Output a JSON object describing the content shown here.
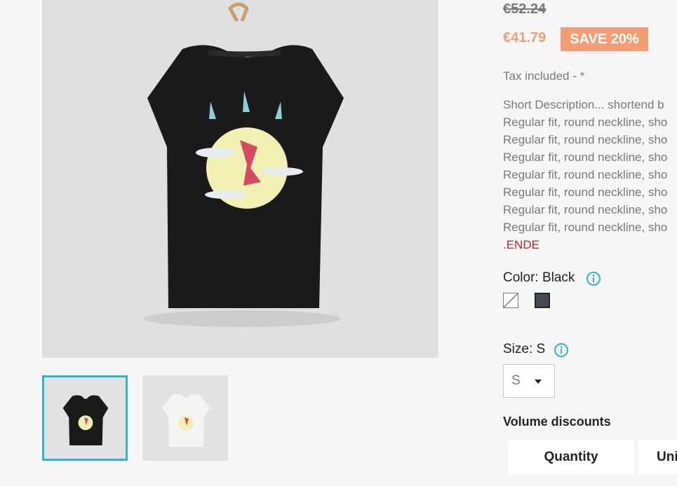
{
  "product": {
    "old_price": "€52.24",
    "price": "€41.79",
    "discount_badge": "SAVE 20%",
    "tax_note": "Tax included - *",
    "description_lines": [
      "Short Description... shortend b",
      "Regular fit, round neckline, sho",
      "Regular fit, round neckline, sho",
      "Regular fit, round neckline, sho",
      "Regular fit, round neckline, sho",
      "Regular fit, round neckline, sho",
      "Regular fit, round neckline, sho",
      "Regular fit, round neckline, sho"
    ],
    "description_end": ".ENDE",
    "color_label": "Color: Black",
    "size_label": "Size: S",
    "size_selected": "S",
    "volume_title": "Volume discounts",
    "volume_headers": [
      "Quantity",
      "Uni"
    ]
  },
  "colors": {
    "accent": "#2fb5d2",
    "price": "#f39d72",
    "swatch_black": "#434a54",
    "end_marker": "#c1272d"
  },
  "icons": {
    "info": "info-circle-icon",
    "dropdown": "caret-down-icon"
  }
}
